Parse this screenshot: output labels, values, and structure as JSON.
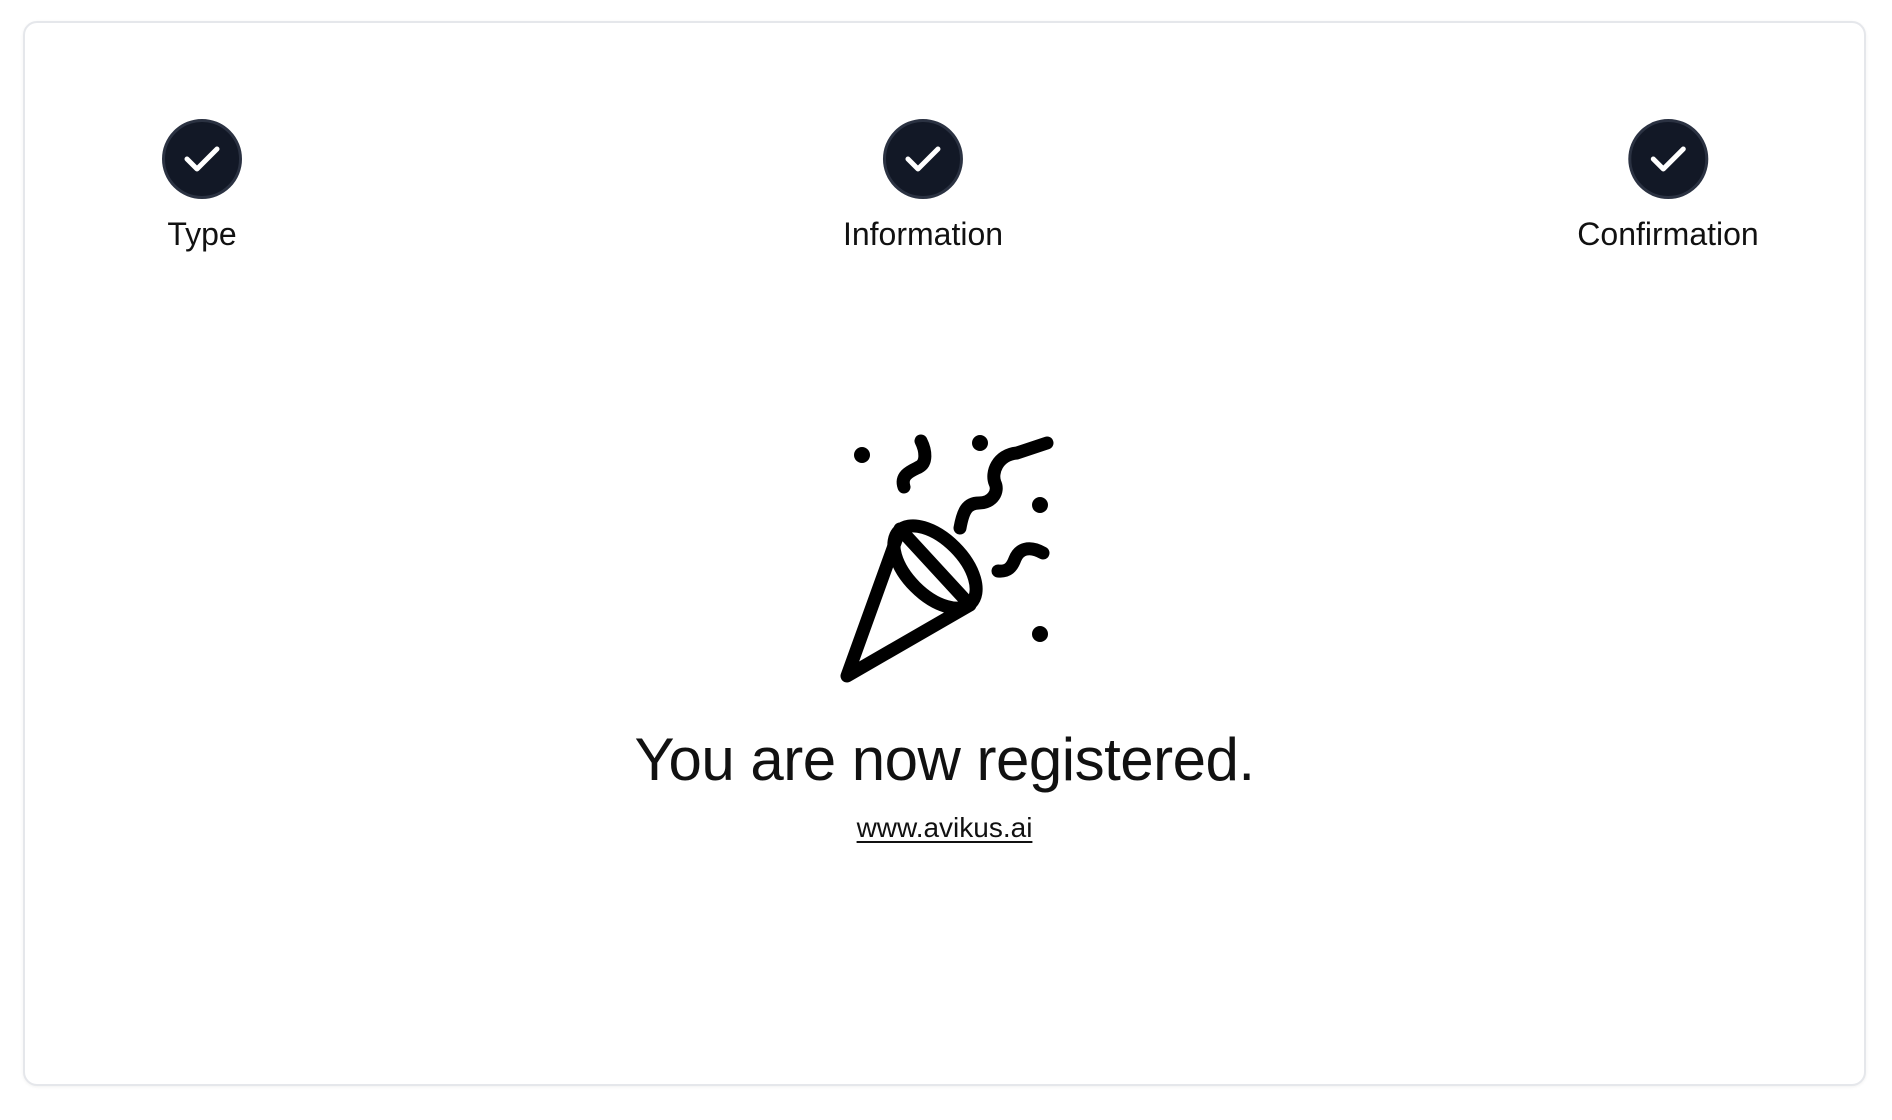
{
  "stepper": {
    "steps": [
      {
        "label": "Type",
        "status": "completed",
        "icon": "check-icon"
      },
      {
        "label": "Information",
        "status": "completed",
        "icon": "check-icon"
      },
      {
        "label": "Confirmation",
        "status": "completed",
        "icon": "check-icon"
      }
    ]
  },
  "confirmation": {
    "icon": "party-popper-icon",
    "headline": "You are now registered.",
    "link_text": "www.avikus.ai"
  },
  "colors": {
    "step_complete": "#121826",
    "text": "#111111",
    "card_border": "#e5e7eb"
  }
}
